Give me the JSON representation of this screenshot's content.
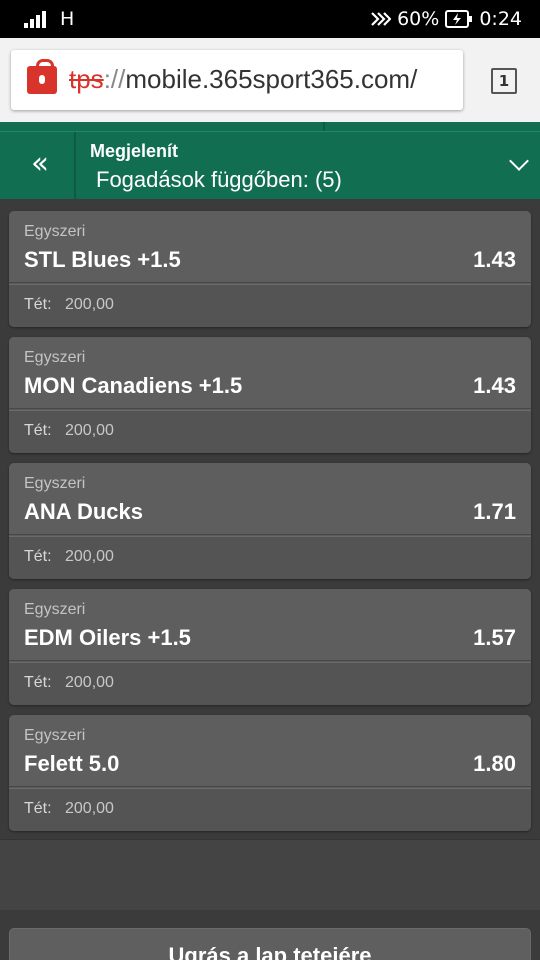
{
  "status_bar": {
    "network": "H",
    "battery": "60%",
    "time": "0:24"
  },
  "browser": {
    "url_scheme": "tps",
    "url_sep": "://",
    "url_host": "mobile.365sport365.com/",
    "tab_count": "1"
  },
  "header": {
    "back_label": "‹‹",
    "label": "Megjelenít",
    "value": "Fogadások függőben: (5)"
  },
  "bets": [
    {
      "type": "Egyszeri",
      "selection": "STL Blues +1.5",
      "odds": "1.43",
      "stake_label": "Tét:",
      "stake": "200,00"
    },
    {
      "type": "Egyszeri",
      "selection": "MON Canadiens +1.5",
      "odds": "1.43",
      "stake_label": "Tét:",
      "stake": "200,00"
    },
    {
      "type": "Egyszeri",
      "selection": "ANA Ducks",
      "odds": "1.71",
      "stake_label": "Tét:",
      "stake": "200,00"
    },
    {
      "type": "Egyszeri",
      "selection": "EDM Oilers +1.5",
      "odds": "1.57",
      "stake_label": "Tét:",
      "stake": "200,00"
    },
    {
      "type": "Egyszeri",
      "selection": "Felett 5.0",
      "odds": "1.80",
      "stake_label": "Tét:",
      "stake": "200,00"
    }
  ],
  "footer": {
    "top_button": "Ugrás a lap tetejére"
  },
  "colors": {
    "brand_green": "#126e51",
    "insecure_red": "#d9342b"
  }
}
